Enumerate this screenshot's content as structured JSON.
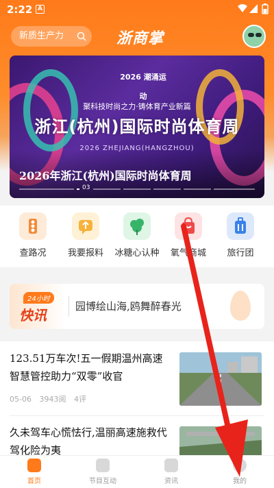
{
  "status_bar": {
    "time": "2:22",
    "notif_glyph": "A"
  },
  "header": {
    "search_placeholder": "新质生产力",
    "app_logo": "浙商掌"
  },
  "banner": {
    "event_logo": "2026 潮涌运动",
    "tagline": "聚科技时尚之力·铸体育产业新篇",
    "headline": "浙江(杭州)国际时尚体育周",
    "sub": "2026 ZHEJIANG(HANGZHOU)",
    "caption": "2026年浙江(杭州)国际时尚体育周",
    "page_number": "03"
  },
  "quick_links": [
    {
      "label": "查路况",
      "icon": "road-condition-icon"
    },
    {
      "label": "我要报料",
      "icon": "report-tip-icon"
    },
    {
      "label": "冰糖心认种",
      "icon": "tree-adopt-icon"
    },
    {
      "label": "氧气商城",
      "icon": "shopping-bag-icon"
    },
    {
      "label": "旅行团",
      "icon": "travel-group-icon"
    }
  ],
  "flash_news": {
    "badge_small": "24小时",
    "badge_title": "快讯",
    "text": "园博绘山海,鸥舞醉春光"
  },
  "news": [
    {
      "title": "123.51万车次!五一假期温州高速智慧管控助力“双零”收官",
      "date": "05-06",
      "views": "3943阅",
      "comments": "4评"
    },
    {
      "title": "久未驾车心慌怯行,温丽高速施救代驾化险为夷"
    }
  ],
  "tabs": [
    {
      "label": "首页",
      "active": true
    },
    {
      "label": "节目互动",
      "active": false
    },
    {
      "label": "资讯",
      "active": false
    },
    {
      "label": "我的",
      "active": false
    }
  ],
  "colors": {
    "accent": "#ff7a1a",
    "arrow": "#e8231b"
  }
}
